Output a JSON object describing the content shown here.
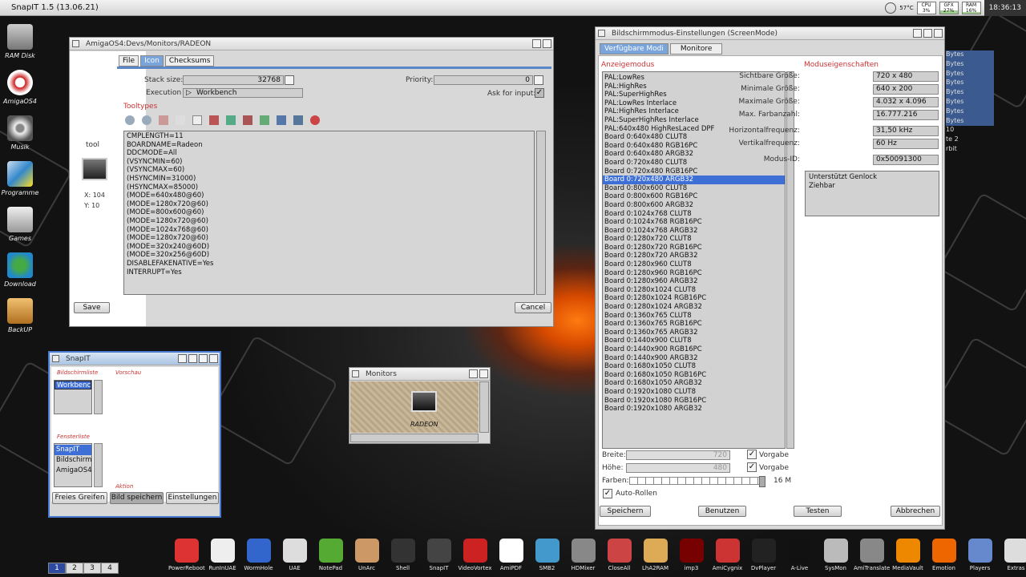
{
  "topbar": {
    "title": "SnapIT 1.5 (13.06.21)",
    "temp": "57°C",
    "cpu_label": "CPU",
    "cpu_val": "3%",
    "cpu_fill": 3,
    "gfx_label": "GFX",
    "gfx_val": "27%",
    "gfx_fill": 27,
    "ram_label": "RAM",
    "ram_val": "16%",
    "ram_fill": 16,
    "clock": "18:36:13"
  },
  "desktop_icons": [
    "RAM Disk",
    "AmigaOS4",
    "Musik",
    "Programme",
    "Games",
    "Download",
    "BackUP"
  ],
  "tool_icon": {
    "label": "tool",
    "x": "X: 104",
    "y": "Y: 10"
  },
  "radeon_win": {
    "title": "AmigaOS4:Devs/Monitors/RADEON",
    "tabs": [
      "File",
      "Icon",
      "Checksums"
    ],
    "stack_label": "Stack size:",
    "stack_value": "32768",
    "priority_label": "Priority:",
    "priority_value": "0",
    "exec_label": "Execution mode:",
    "exec_value": "Workbench",
    "ask_label": "Ask for input:",
    "tooltypes_label": "Tooltypes",
    "tooltypes": [
      "CMPLENGTH=11",
      "BOARDNAME=Radeon",
      "DDCMODE=All",
      "(VSYNCMIN=60)",
      "(VSYNCMAX=60)",
      "(HSYNCMIN=31000)",
      "(HSYNCMAX=85000)",
      "(MODE=640x480@60)",
      "(MODE=1280x720@60)",
      "(MODE=800x600@60)",
      "(MODE=1280x720@60)",
      "(MODE=1024x768@60)",
      "(MODE=1280x720@60)",
      "(MODE=320x240@60D)",
      "(MODE=320x256@60D)",
      "DISABLEFAKENATIVE=Yes",
      "INTERRUPT=Yes"
    ],
    "save": "Save",
    "cancel": "Cancel"
  },
  "screenmode_win": {
    "title": "Bildschirmmodus-Einstellungen (ScreenMode)",
    "tabs": [
      "Verfügbare Modi",
      "Monitore"
    ],
    "mode_header": "Anzeigemodus",
    "props_header": "Moduseigenschaften",
    "modes": [
      "PAL:LowRes",
      "PAL:HighRes",
      "PAL:SuperHighRes",
      "PAL:LowRes Interlace",
      "PAL:HighRes Interlace",
      "PAL:SuperHighRes Interlace",
      "PAL:640x480 HighResLaced DPF",
      "Board 0:640x480 CLUT8",
      "Board 0:640x480 RGB16PC",
      "Board 0:640x480 ARGB32",
      "Board 0:720x480 CLUT8",
      "Board 0:720x480 RGB16PC",
      "Board 0:720x480 ARGB32",
      "Board 0:800x600 CLUT8",
      "Board 0:800x600 RGB16PC",
      "Board 0:800x600 ARGB32",
      "Board 0:1024x768 CLUT8",
      "Board 0:1024x768 RGB16PC",
      "Board 0:1024x768 ARGB32",
      "Board 0:1280x720 CLUT8",
      "Board 0:1280x720 RGB16PC",
      "Board 0:1280x720 ARGB32",
      "Board 0:1280x960 CLUT8",
      "Board 0:1280x960 RGB16PC",
      "Board 0:1280x960 ARGB32",
      "Board 0:1280x1024 CLUT8",
      "Board 0:1280x1024 RGB16PC",
      "Board 0:1280x1024 ARGB32",
      "Board 0:1360x765 CLUT8",
      "Board 0:1360x765 RGB16PC",
      "Board 0:1360x765 ARGB32",
      "Board 0:1440x900 CLUT8",
      "Board 0:1440x900 RGB16PC",
      "Board 0:1440x900 ARGB32",
      "Board 0:1680x1050 CLUT8",
      "Board 0:1680x1050 RGB16PC",
      "Board 0:1680x1050 ARGB32",
      "Board 0:1920x1080 CLUT8",
      "Board 0:1920x1080 RGB16PC",
      "Board 0:1920x1080 ARGB32"
    ],
    "selected_mode_index": 12,
    "props": [
      {
        "label": "Sichtbare Größe:",
        "value": "720 x 480"
      },
      {
        "label": "Minimale Größe:",
        "value": "640 x 200"
      },
      {
        "label": "Maximale Größe:",
        "value": "4.032 x 4.096"
      },
      {
        "label": "Max. Farbanzahl:",
        "value": "16.777.216"
      },
      {
        "label": "Horizontalfrequenz:",
        "value": "31,50 kHz"
      },
      {
        "label": "Vertikalfrequenz:",
        "value": "60 Hz"
      },
      {
        "label": "Modus-ID:",
        "value": "0x50091300"
      }
    ],
    "features": [
      "Unterstützt Genlock",
      "Ziehbar"
    ],
    "width_label": "Breite:",
    "width_value": "720",
    "height_label": "Höhe:",
    "height_value": "480",
    "default_label": "Vorgabe",
    "colors_label": "Farben:",
    "colors_value": "16 M",
    "autoscroll_label": "Auto-Rollen",
    "buttons": [
      "Speichern",
      "Benutzen",
      "Testen",
      "Abbrechen"
    ]
  },
  "right_edge_texts": [
    "Bytes",
    "Bytes",
    "Bytes",
    "Bytes",
    "Bytes",
    "Bytes",
    "Bytes",
    "Bytes",
    "10",
    "te 2",
    "rbit"
  ],
  "snapit_win": {
    "title": "SnapIT",
    "screenlist_label": "Bildschirmliste",
    "screen_item": "Workbench",
    "preview_label": "Vorschau",
    "windowlist_label": "Fensterliste",
    "windows": [
      "SnapIT",
      "Bildschirm",
      "AmigaOS4"
    ],
    "action_label": "Aktion",
    "buttons": [
      "Freies Greifen",
      "Bild speichern",
      "Einstellungen"
    ]
  },
  "monitors_win": {
    "title": "Monitors",
    "icon_label": "RADEON"
  },
  "dock": [
    "PowerReboot",
    "RunInUAE",
    "WormHole",
    "UAE",
    "NotePad",
    "UnArc",
    "Shell",
    "SnapIT",
    "VideoVortex",
    "AmiPDF",
    "SMB2",
    "HDMixer",
    "CloseAll",
    "LhA2RAM",
    "imp3",
    "AmiCygnix",
    "DvPlayer",
    "A-Live",
    "SysMon",
    "AmiTranslate",
    "MediaVault",
    "Emotion",
    "Players",
    "Extras",
    "Internet"
  ],
  "pager": [
    "1",
    "2",
    "3",
    "4"
  ]
}
